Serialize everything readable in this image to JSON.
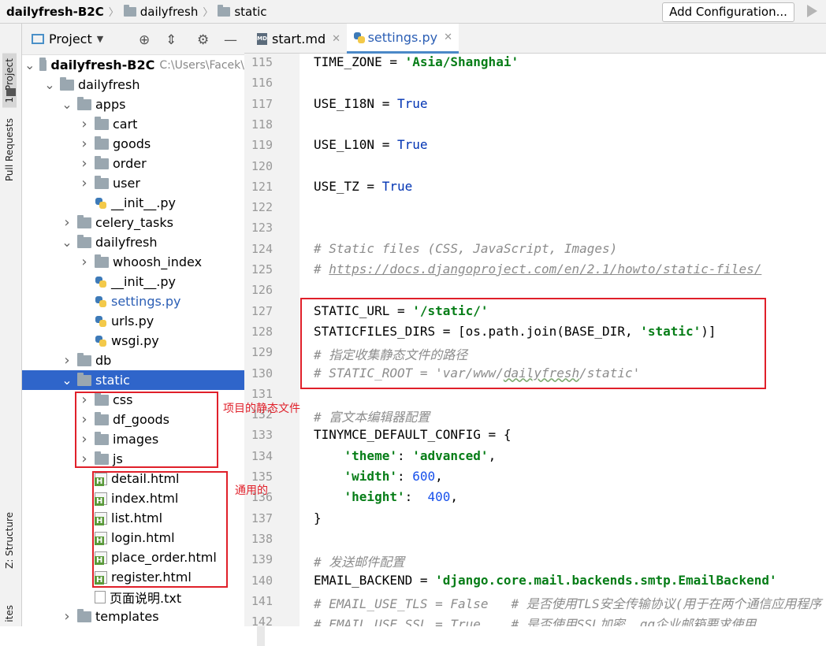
{
  "breadcrumb": {
    "project": "dailyfresh-B2C",
    "folder1": "dailyfresh",
    "folder2": "static"
  },
  "toolbar": {
    "add_config": "Add Configuration..."
  },
  "side_tabs": {
    "project": "1: Project",
    "pull_requests": "Pull Requests",
    "structure": "Z: Structure",
    "favorites": "ites"
  },
  "project_panel": {
    "title": "Project"
  },
  "tree": [
    {
      "label": "dailyfresh-B2C",
      "hint": "C:\\Users\\Facek\\",
      "type": "folder",
      "level": 0,
      "expanded": true,
      "bold": true
    },
    {
      "label": "dailyfresh",
      "type": "folder",
      "level": 1,
      "expanded": true
    },
    {
      "label": "apps",
      "type": "folder",
      "level": 2,
      "expanded": true
    },
    {
      "label": "cart",
      "type": "folder",
      "level": 3,
      "expanded": false
    },
    {
      "label": "goods",
      "type": "folder",
      "level": 3,
      "expanded": false
    },
    {
      "label": "order",
      "type": "folder",
      "level": 3,
      "expanded": false
    },
    {
      "label": "user",
      "type": "folder",
      "level": 3,
      "expanded": false
    },
    {
      "label": "__init__.py",
      "type": "py",
      "level": 3
    },
    {
      "label": "celery_tasks",
      "type": "folder",
      "level": 2,
      "expanded": false
    },
    {
      "label": "dailyfresh",
      "type": "folder",
      "level": 2,
      "expanded": true
    },
    {
      "label": "whoosh_index",
      "type": "folder",
      "level": 3,
      "expanded": false
    },
    {
      "label": "__init__.py",
      "type": "py",
      "level": 3
    },
    {
      "label": "settings.py",
      "type": "py",
      "level": 3,
      "active": true
    },
    {
      "label": "urls.py",
      "type": "py",
      "level": 3
    },
    {
      "label": "wsgi.py",
      "type": "py",
      "level": 3
    },
    {
      "label": "db",
      "type": "folder",
      "level": 2,
      "expanded": false
    },
    {
      "label": "static",
      "type": "folder",
      "level": 2,
      "expanded": true,
      "selected": true
    },
    {
      "label": "css",
      "type": "folder",
      "level": 3,
      "expanded": false
    },
    {
      "label": "df_goods",
      "type": "folder",
      "level": 3,
      "expanded": false
    },
    {
      "label": "images",
      "type": "folder",
      "level": 3,
      "expanded": false
    },
    {
      "label": "js",
      "type": "folder",
      "level": 3,
      "expanded": false
    },
    {
      "label": "detail.html",
      "type": "html",
      "level": 3
    },
    {
      "label": "index.html",
      "type": "html",
      "level": 3
    },
    {
      "label": "list.html",
      "type": "html",
      "level": 3
    },
    {
      "label": "login.html",
      "type": "html",
      "level": 3
    },
    {
      "label": "place_order.html",
      "type": "html",
      "level": 3
    },
    {
      "label": "register.html",
      "type": "html",
      "level": 3
    },
    {
      "label": "页面说明.txt",
      "type": "txt",
      "level": 3
    },
    {
      "label": "templates",
      "type": "folder",
      "level": 2,
      "expanded": false
    }
  ],
  "annotations": {
    "static_dirs": "项目的静态文件",
    "common": "通用的"
  },
  "tabs": [
    {
      "label": "start.md",
      "icon": "md-file-icon",
      "active": false,
      "icon_text": "MD"
    },
    {
      "label": "settings.py",
      "icon": "python-file-icon",
      "active": true
    }
  ],
  "editor": {
    "lines": [
      {
        "n": "115",
        "parts": [
          [
            "",
            "TIME_ZONE = "
          ],
          [
            "str",
            "'Asia/Shanghai'"
          ]
        ]
      },
      {
        "n": "116",
        "parts": []
      },
      {
        "n": "117",
        "parts": [
          [
            "",
            "USE_I18N = "
          ],
          [
            "kw",
            "True"
          ]
        ]
      },
      {
        "n": "118",
        "parts": []
      },
      {
        "n": "119",
        "parts": [
          [
            "",
            "USE_L10N = "
          ],
          [
            "kw",
            "True"
          ]
        ]
      },
      {
        "n": "120",
        "parts": []
      },
      {
        "n": "121",
        "parts": [
          [
            "",
            "USE_TZ = "
          ],
          [
            "kw",
            "True"
          ]
        ]
      },
      {
        "n": "122",
        "parts": []
      },
      {
        "n": "123",
        "parts": []
      },
      {
        "n": "124",
        "fold": true,
        "parts": [
          [
            "cm",
            "# Static files (CSS, JavaScript, Images)"
          ]
        ]
      },
      {
        "n": "125",
        "fold": true,
        "parts": [
          [
            "cm",
            "# "
          ],
          [
            "cmu",
            "https://docs.djangoproject.com/en/2.1/howto/static-files/"
          ]
        ]
      },
      {
        "n": "126",
        "parts": []
      },
      {
        "n": "127",
        "parts": [
          [
            "",
            "STATIC_URL = "
          ],
          [
            "str",
            "'/static/'"
          ]
        ]
      },
      {
        "n": "128",
        "parts": [
          [
            "",
            "STATICFILES_DIRS = [os.path.join(BASE_DIR, "
          ],
          [
            "str",
            "'static'"
          ],
          [
            "",
            ")]"
          ]
        ]
      },
      {
        "n": "129",
        "fold": true,
        "parts": [
          [
            "cm",
            "# 指定收集静态文件的路径"
          ]
        ]
      },
      {
        "n": "130",
        "fold": true,
        "parts": [
          [
            "cm",
            "# STATIC_ROOT = 'var/www/"
          ],
          [
            "cmw",
            "dailyfresh"
          ],
          [
            "cm",
            "/static'"
          ]
        ]
      },
      {
        "n": "131",
        "parts": []
      },
      {
        "n": "132",
        "fold": true,
        "parts": [
          [
            "cm",
            "# 富文本编辑器配置"
          ]
        ]
      },
      {
        "n": "133",
        "fold": true,
        "parts": [
          [
            "",
            "TINYMCE_DEFAULT_CONFIG = {"
          ]
        ]
      },
      {
        "n": "134",
        "parts": [
          [
            "",
            "    "
          ],
          [
            "str",
            "'theme'"
          ],
          [
            "",
            ": "
          ],
          [
            "str",
            "'advanced'"
          ],
          [
            "",
            ","
          ]
        ]
      },
      {
        "n": "135",
        "parts": [
          [
            "",
            "    "
          ],
          [
            "str",
            "'width'"
          ],
          [
            "",
            ": "
          ],
          [
            "num",
            "600"
          ],
          [
            "",
            ","
          ]
        ]
      },
      {
        "n": "136",
        "parts": [
          [
            "",
            "    "
          ],
          [
            "str",
            "'height'"
          ],
          [
            "",
            ":  "
          ],
          [
            "num",
            "400"
          ],
          [
            "",
            ","
          ]
        ]
      },
      {
        "n": "137",
        "fold": true,
        "parts": [
          [
            "",
            "}"
          ]
        ]
      },
      {
        "n": "138",
        "parts": []
      },
      {
        "n": "139",
        "parts": [
          [
            "cm",
            "# 发送邮件配置"
          ]
        ]
      },
      {
        "n": "140",
        "parts": [
          [
            "",
            "EMAIL_BACKEND = "
          ],
          [
            "str",
            "'django.core.mail.backends.smtp.EmailBackend'"
          ]
        ]
      },
      {
        "n": "141",
        "fold": true,
        "parts": [
          [
            "cm",
            "# EMAIL_USE_TLS = False   # 是否使用TLS安全传输协议(用于在两个通信应用程序"
          ]
        ]
      },
      {
        "n": "142",
        "parts": [
          [
            "cm",
            "# EMAIL_USE_SSL = True    # 是否使用SSL加密, qq企业邮箱要求使用"
          ]
        ]
      }
    ]
  }
}
